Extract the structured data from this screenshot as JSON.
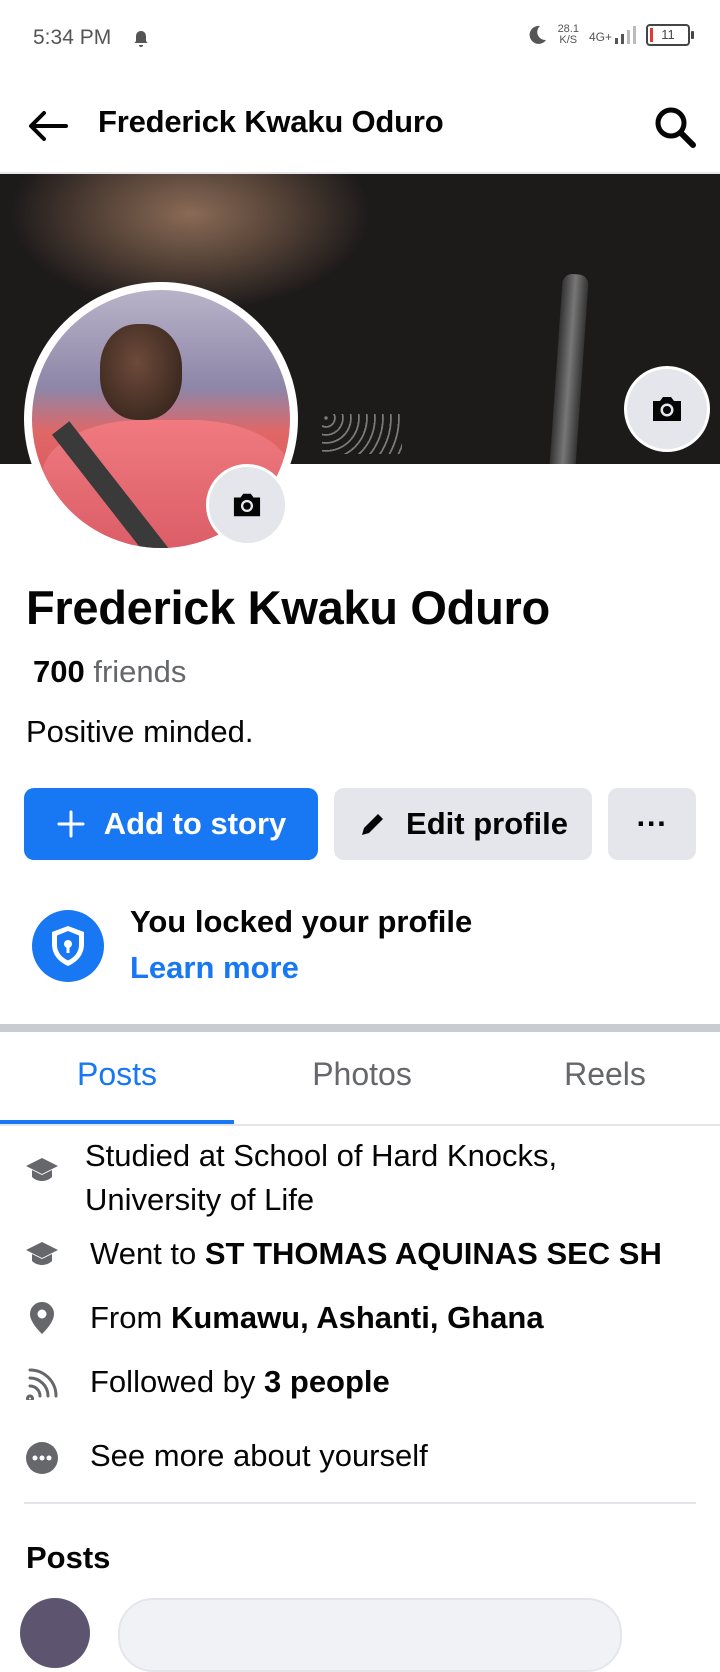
{
  "status_bar": {
    "time": "5:34 PM",
    "speed_value": "28.1",
    "speed_unit": "K/S",
    "network": "4G+",
    "battery": "11"
  },
  "header": {
    "title": "Frederick Kwaku Oduro"
  },
  "profile": {
    "name": "Frederick Kwaku Oduro",
    "friends_count": "700",
    "friends_label": "friends",
    "bio": "Positive minded."
  },
  "actions": {
    "add_story": "Add to story",
    "edit_profile": "Edit profile",
    "more": "···"
  },
  "lock_notice": {
    "title": "You locked your profile",
    "link": "Learn more"
  },
  "tabs": [
    {
      "label": "Posts",
      "active": true
    },
    {
      "label": "Photos"
    },
    {
      "label": "Reels"
    }
  ],
  "intro": {
    "studied_line1": "Studied at School of Hard Knocks,",
    "studied_line2": "University of Life",
    "went_prefix": "Went to ",
    "went_place": "ST THOMAS AQUINAS SEC SH",
    "from_prefix": "From ",
    "from_place": "Kumawu, Ashanti, Ghana",
    "followed_prefix": "Followed by ",
    "followed_count": "3 people",
    "see_more": "See more about yourself"
  },
  "posts_section": {
    "heading": "Posts"
  },
  "colors": {
    "accent": "#1877f2",
    "secondary_button": "#e4e6eb",
    "muted_text": "#65676b"
  },
  "icons": [
    "bell-icon",
    "moon-icon",
    "signal-icon",
    "battery-icon",
    "back-arrow-icon",
    "search-icon",
    "camera-icon",
    "plus-icon",
    "pencil-icon",
    "shield-lock-icon",
    "graduation-cap-icon",
    "location-pin-icon",
    "rss-icon",
    "more-dots-icon"
  ]
}
